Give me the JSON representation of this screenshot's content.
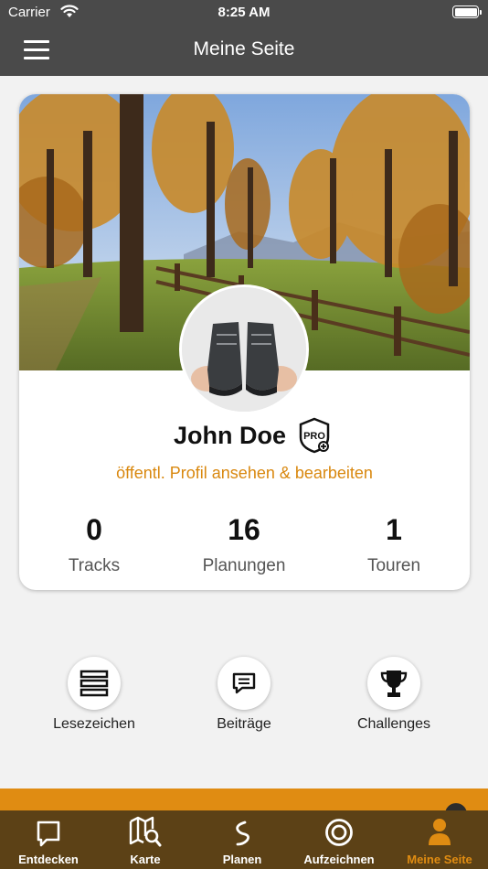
{
  "status_bar": {
    "carrier": "Carrier",
    "time": "8:25 AM"
  },
  "nav": {
    "title": "Meine Seite"
  },
  "profile": {
    "name": "John Doe",
    "badge": "PRO",
    "link_text": "öffentl. Profil ansehen & bearbeiten",
    "stats": [
      {
        "value": "0",
        "label": "Tracks"
      },
      {
        "value": "16",
        "label": "Planungen"
      },
      {
        "value": "1",
        "label": "Touren"
      }
    ]
  },
  "actions": [
    {
      "label": "Lesezeichen",
      "icon": "bookmarks-list-icon"
    },
    {
      "label": "Beiträge",
      "icon": "chat-bubble-icon"
    },
    {
      "label": "Challenges",
      "icon": "trophy-icon"
    }
  ],
  "tabs": [
    {
      "label": "Entdecken",
      "icon": "speech-bubble-icon",
      "active": false
    },
    {
      "label": "Karte",
      "icon": "map-search-icon",
      "active": false
    },
    {
      "label": "Planen",
      "icon": "route-icon",
      "active": false
    },
    {
      "label": "Aufzeichnen",
      "icon": "record-icon",
      "active": false
    },
    {
      "label": "Meine Seite",
      "icon": "person-icon",
      "active": true
    }
  ],
  "colors": {
    "accent": "#e08c12",
    "header": "#4a4a4a",
    "tab_bar": "#5c4116"
  }
}
